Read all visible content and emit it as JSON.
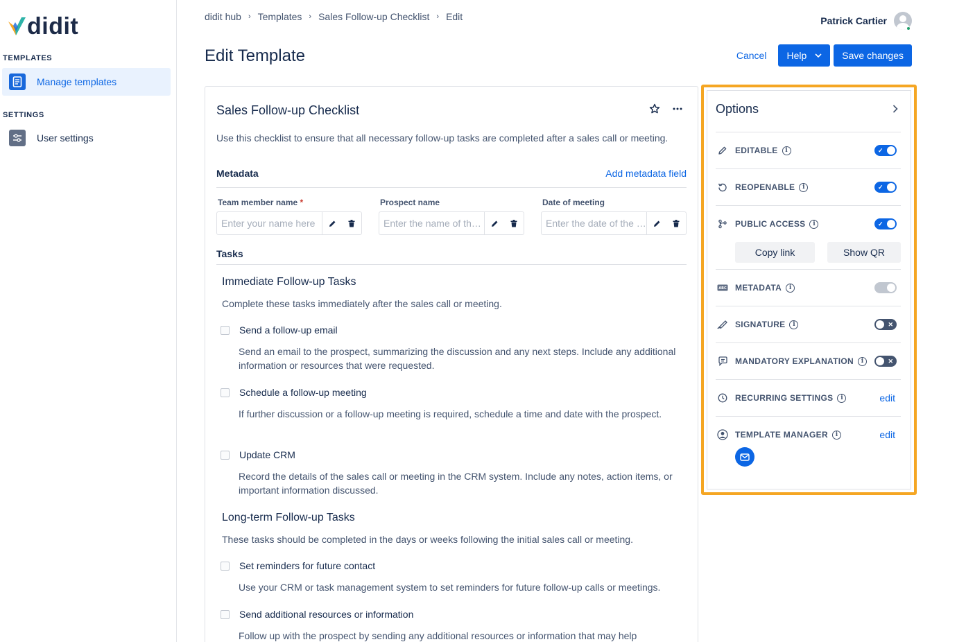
{
  "app": {
    "logo_text": "didit"
  },
  "sidebar": {
    "section_templates": "TEMPLATES",
    "item_manage": "Manage templates",
    "section_settings": "SETTINGS",
    "item_user_settings": "User settings"
  },
  "breadcrumb": [
    "didit hub",
    "Templates",
    "Sales Follow-up Checklist",
    "Edit"
  ],
  "user": {
    "name": "Patrick Cartier"
  },
  "page": {
    "title": "Edit Template"
  },
  "actions": {
    "cancel": "Cancel",
    "help": "Help",
    "save": "Save changes"
  },
  "template": {
    "name": "Sales Follow-up Checklist",
    "description": "Use this checklist to ensure that all necessary follow-up tasks are completed after a sales call or meeting.",
    "metadata_heading": "Metadata",
    "add_metadata": "Add metadata field",
    "metadata_fields": [
      {
        "label": "Team member name",
        "required": "*",
        "placeholder": "Enter your name here"
      },
      {
        "label": "Prospect name",
        "required": "",
        "placeholder": "Enter the name of the prospect"
      },
      {
        "label": "Date of meeting",
        "required": "",
        "placeholder": "Enter the date of the meeting"
      }
    ],
    "tasks_heading": "Tasks",
    "groups": [
      {
        "title": "Immediate Follow-up Tasks",
        "description": "Complete these tasks immediately after the sales call or meeting.",
        "tasks": [
          {
            "name": "Send a follow-up email",
            "description": "Send an email to the prospect, summarizing the discussion and any next steps. Include any additional information or resources that were requested."
          },
          {
            "name": "Schedule a follow-up meeting",
            "description": "If further discussion or a follow-up meeting is required, schedule a time and date with the prospect."
          },
          {
            "name": "Update CRM",
            "description": "Record the details of the sales call or meeting in the CRM system. Include any notes, action items, or important information discussed."
          }
        ]
      },
      {
        "title": "Long-term Follow-up Tasks",
        "description": "These tasks should be completed in the days or weeks following the initial sales call or meeting.",
        "tasks": [
          {
            "name": "Set reminders for future contact",
            "description": "Use your CRM or task management system to set reminders for future follow-up calls or meetings."
          },
          {
            "name": "Send additional resources or information",
            "description": "Follow up with the prospect by sending any additional resources or information that may help"
          }
        ]
      }
    ]
  },
  "options": {
    "title": "Options",
    "editable": {
      "label": "EDITABLE",
      "state": "on"
    },
    "reopenable": {
      "label": "REOPENABLE",
      "state": "on"
    },
    "public_access": {
      "label": "PUBLIC ACCESS",
      "state": "on",
      "copy_link": "Copy link",
      "show_qr": "Show QR"
    },
    "metadata": {
      "label": "METADATA",
      "state": "disabled-on"
    },
    "signature": {
      "label": "SIGNATURE",
      "state": "off"
    },
    "mandatory_explanation": {
      "label": "MANDATORY EXPLANATION",
      "state": "off"
    },
    "recurring": {
      "label": "RECURRING SETTINGS",
      "action": "edit"
    },
    "template_manager": {
      "label": "TEMPLATE MANAGER",
      "action": "edit"
    },
    "toggle_on_mark": "✓",
    "toggle_off_mark": "✕",
    "info_glyph": "i"
  },
  "colors": {
    "accent": "#0c66e4",
    "highlight": "#f5a623",
    "logo_blue": "#1d2b48"
  }
}
